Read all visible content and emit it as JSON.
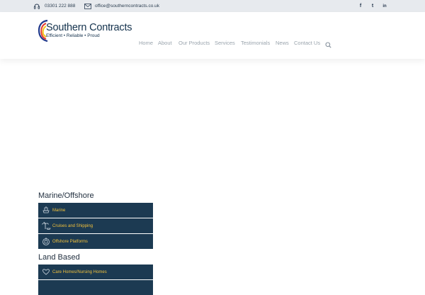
{
  "topbar": {
    "phone": "03301 222 888",
    "email": "office@southerncontracts.co.uk",
    "social": [
      "f",
      "t",
      "in"
    ]
  },
  "logo": {
    "title": "Southern Contracts",
    "tagline": "Efficient • Reliable • Proud"
  },
  "nav": {
    "items": [
      "Home",
      "About",
      "Our Products",
      "Services",
      "Testimonials",
      "News",
      "Contact Us"
    ]
  },
  "sidebar": {
    "section1": {
      "title": "Marine/Offshore",
      "items": [
        "Marine",
        "Cruises and Shipping",
        "Offshore Platforms"
      ]
    },
    "section2": {
      "title": "Land Based",
      "items": [
        "Care Homes/Nursing Homes"
      ]
    }
  },
  "colors": {
    "menu_bg": "#1c3a52",
    "menu_text": "#f2c13b",
    "nav_text": "#9aa4ad",
    "topbar_bg": "#e7eaee"
  }
}
